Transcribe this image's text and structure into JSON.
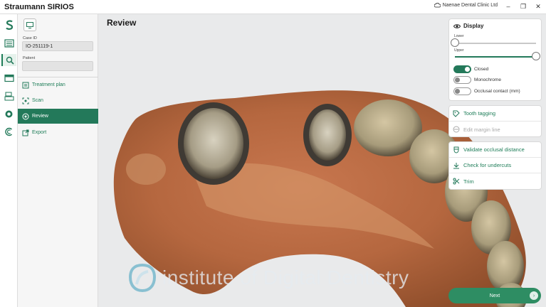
{
  "app": {
    "title": "Straumann SIRIOS",
    "clinic": "Naenae Dental Clinic Ltd",
    "window_controls": [
      "minimize-icon",
      "restore-icon",
      "close-icon"
    ]
  },
  "rail": {
    "items": [
      "straumann-logo-icon",
      "patient-list-icon",
      "search-icon",
      "folder-icon",
      "scanner-icon",
      "circle-icon",
      "logo-c-icon"
    ]
  },
  "case": {
    "case_id_label": "Case ID",
    "case_id_value": "IO-251119-1",
    "patient_label": "Patient",
    "patient_value": ""
  },
  "nav": [
    {
      "label": "Treatment plan",
      "icon": "clipboard-icon",
      "active": false
    },
    {
      "label": "Scan",
      "icon": "scan-icon",
      "active": false
    },
    {
      "label": "Review",
      "icon": "review-icon",
      "active": true
    },
    {
      "label": "Export",
      "icon": "export-icon",
      "active": false
    }
  ],
  "main": {
    "title": "Review",
    "watermark": "institute of Digital Dentistry"
  },
  "display": {
    "title": "Display",
    "lower_label": "Lower",
    "upper_label": "Upper",
    "lower_value": 0.0,
    "upper_value": 1.0,
    "toggles": [
      {
        "label": "Closed",
        "on": true
      },
      {
        "label": "Monochrome",
        "on": false
      },
      {
        "label": "Occlusal contact (mm)",
        "on": false
      }
    ]
  },
  "tools_a": [
    {
      "label": "Tooth tagging",
      "icon": "tooth-tag-icon",
      "enabled": true
    },
    {
      "label": "Edit margin line",
      "icon": "margin-line-icon",
      "enabled": false
    }
  ],
  "tools_b": [
    {
      "label": "Validate occlusal distance",
      "icon": "occlusal-distance-icon",
      "enabled": true
    },
    {
      "label": "Check for undercuts",
      "icon": "undercut-icon",
      "enabled": true
    },
    {
      "label": "Trim",
      "icon": "scissors-icon",
      "enabled": true
    }
  ],
  "footer": {
    "next_label": "Next"
  },
  "colors": {
    "accent": "#23795a",
    "accent_light": "#2e8d63"
  }
}
